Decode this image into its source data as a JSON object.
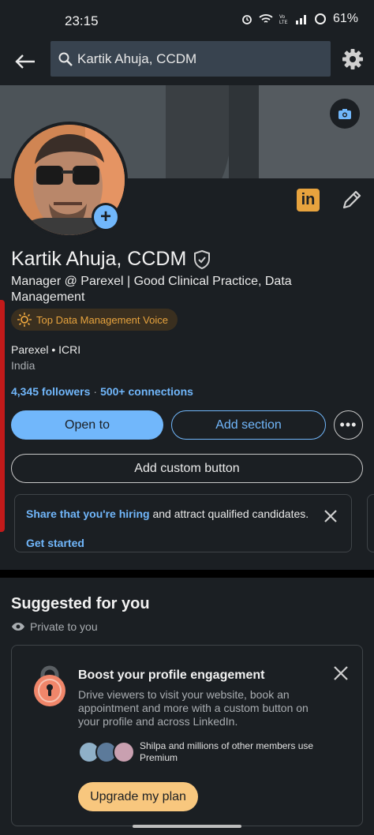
{
  "status_bar": {
    "time": "23:15",
    "battery": "61%"
  },
  "search": {
    "query": "Kartik Ahuja, CCDM"
  },
  "profile": {
    "name": "Kartik Ahuja, CCDM",
    "headline": "Manager @ Parexel | Good Clinical Practice, Data Management",
    "voice_badge": "Top Data Management Voice",
    "company": "Parexel • ICRI",
    "location": "India",
    "followers": "4,345 followers",
    "connections": "500+ connections",
    "linkedin_badge": "in"
  },
  "actions": {
    "open_to": "Open to",
    "add_section": "Add section",
    "more": "•••",
    "add_custom_button": "Add custom button"
  },
  "hiring_card": {
    "highlight": "Share that you're hiring",
    "text": " and attract qualified candidates.",
    "link": "Get started"
  },
  "suggested": {
    "title": "Suggested for you",
    "private": "Private to you",
    "card": {
      "title": "Boost your profile engagement",
      "description": "Drive viewers to visit your website, book an appointment and more with a custom button on your profile and across LinkedIn.",
      "members": "Shilpa and millions of other members use Premium",
      "button": "Upgrade my plan"
    }
  },
  "colors": {
    "accent": "#71b7fb",
    "premium": "#f8c77e",
    "background": "#1b1f23"
  }
}
